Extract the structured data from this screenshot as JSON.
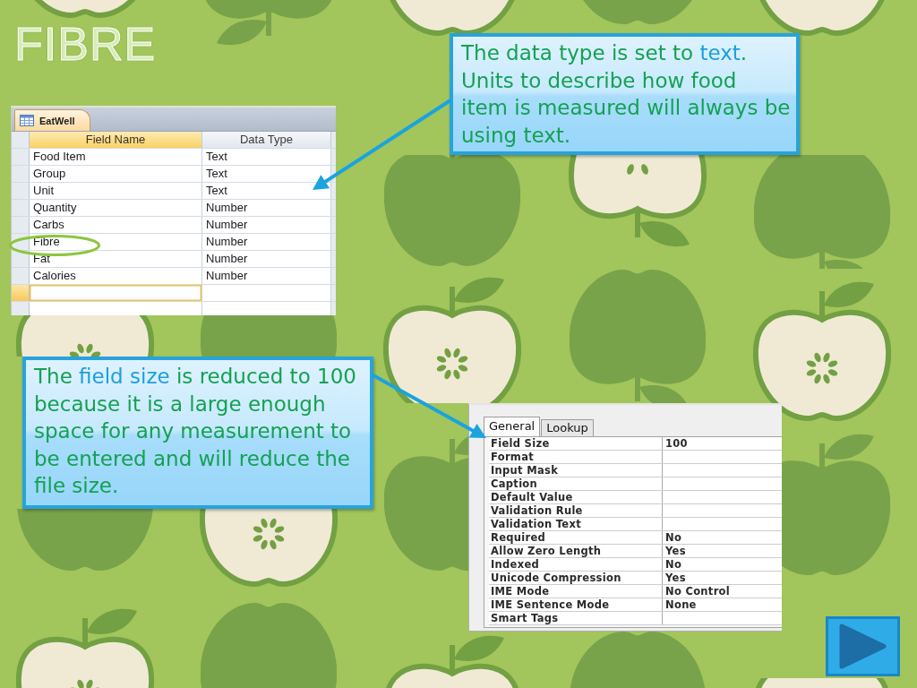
{
  "title": "FIBRE",
  "datasheet": {
    "tab": "EatWell",
    "columns": [
      {
        "label": "Field Name",
        "selected": true
      },
      {
        "label": "Data Type",
        "selected": false
      }
    ],
    "rows": [
      {
        "field_name": "Food Item",
        "data_type": "Text",
        "circled": false
      },
      {
        "field_name": "Group",
        "data_type": "Text",
        "circled": false
      },
      {
        "field_name": "Unit",
        "data_type": "Text",
        "circled": false
      },
      {
        "field_name": "Quantity",
        "data_type": "Number",
        "circled": false
      },
      {
        "field_name": "Carbs",
        "data_type": "Number",
        "circled": false
      },
      {
        "field_name": "Fibre",
        "data_type": "Number",
        "circled": true
      },
      {
        "field_name": "Fat",
        "data_type": "Number",
        "circled": false
      },
      {
        "field_name": "Calories",
        "data_type": "Number",
        "circled": false
      }
    ],
    "new_row_selected": true
  },
  "callouts": [
    {
      "segments": [
        {
          "text": "The data type is set to ",
          "highlighted": false
        },
        {
          "text": "text",
          "highlighted": true
        },
        {
          "text": ".\nUnits to describe how food\nitem is measured will always be\nusing text.",
          "highlighted": false
        }
      ]
    },
    {
      "segments": [
        {
          "text": "The ",
          "highlighted": false
        },
        {
          "text": "field size",
          "highlighted": true
        },
        {
          "text": " is reduced to 100\nbecause it is a large enough\nspace for any measurement to\nbe entered and will reduce the\nfile size.",
          "highlighted": false
        }
      ]
    }
  ],
  "property_sheet": {
    "tabs": [
      {
        "label": "General",
        "selected": true
      },
      {
        "label": "Lookup",
        "selected": false
      }
    ],
    "properties": [
      {
        "name": "Field Size",
        "value": "100"
      },
      {
        "name": "Format"
      },
      {
        "name": "Input Mask"
      },
      {
        "name": "Caption"
      },
      {
        "name": "Default Value"
      },
      {
        "name": "Validation Rule"
      },
      {
        "name": "Validation Text"
      },
      {
        "name": "Required",
        "value": "No"
      },
      {
        "name": "Allow Zero Length",
        "value": "Yes"
      },
      {
        "name": "Indexed",
        "value": "No"
      },
      {
        "name": "Unicode Compression",
        "value": "Yes"
      },
      {
        "name": "IME Mode",
        "value": "No Control"
      },
      {
        "name": "IME Sentence Mode",
        "value": "None"
      },
      {
        "name": "Smart Tags"
      }
    ]
  }
}
